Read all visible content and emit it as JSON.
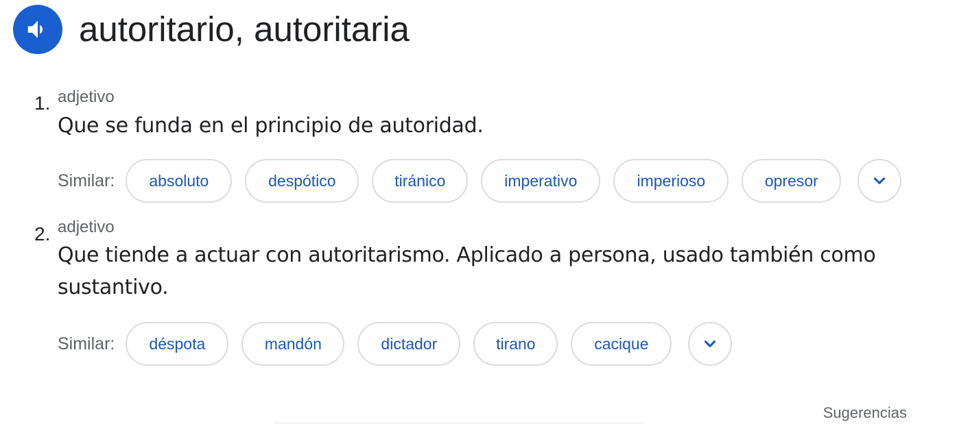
{
  "entry": {
    "headword": "autoritario, autoritaria",
    "speaker_icon": "volume-up-icon"
  },
  "senses": [
    {
      "number": "1.",
      "part_of_speech": "adjetivo",
      "definition": "Que se funda en el principio de autoridad.",
      "similar_label": "Similar:",
      "similar": [
        "absoluto",
        "despótico",
        "tiránico",
        "imperativo",
        "imperioso",
        "opresor"
      ],
      "expand_icon": "chevron-down-icon"
    },
    {
      "number": "2.",
      "part_of_speech": "adjetivo",
      "definition": "Que tiende a actuar con autoritarismo. Aplicado a persona, usado también como sustantivo.",
      "similar_label": "Similar:",
      "similar": [
        "déspota",
        "mandón",
        "dictador",
        "tirano",
        "cacique"
      ],
      "expand_icon": "chevron-down-icon"
    }
  ],
  "footer": {
    "suggestions_label": "Sugerencias"
  },
  "colors": {
    "accent": "#1a5fd0",
    "chip_text": "#1a56c4",
    "chip_border": "#dadce0",
    "muted_text": "#5f6368"
  }
}
